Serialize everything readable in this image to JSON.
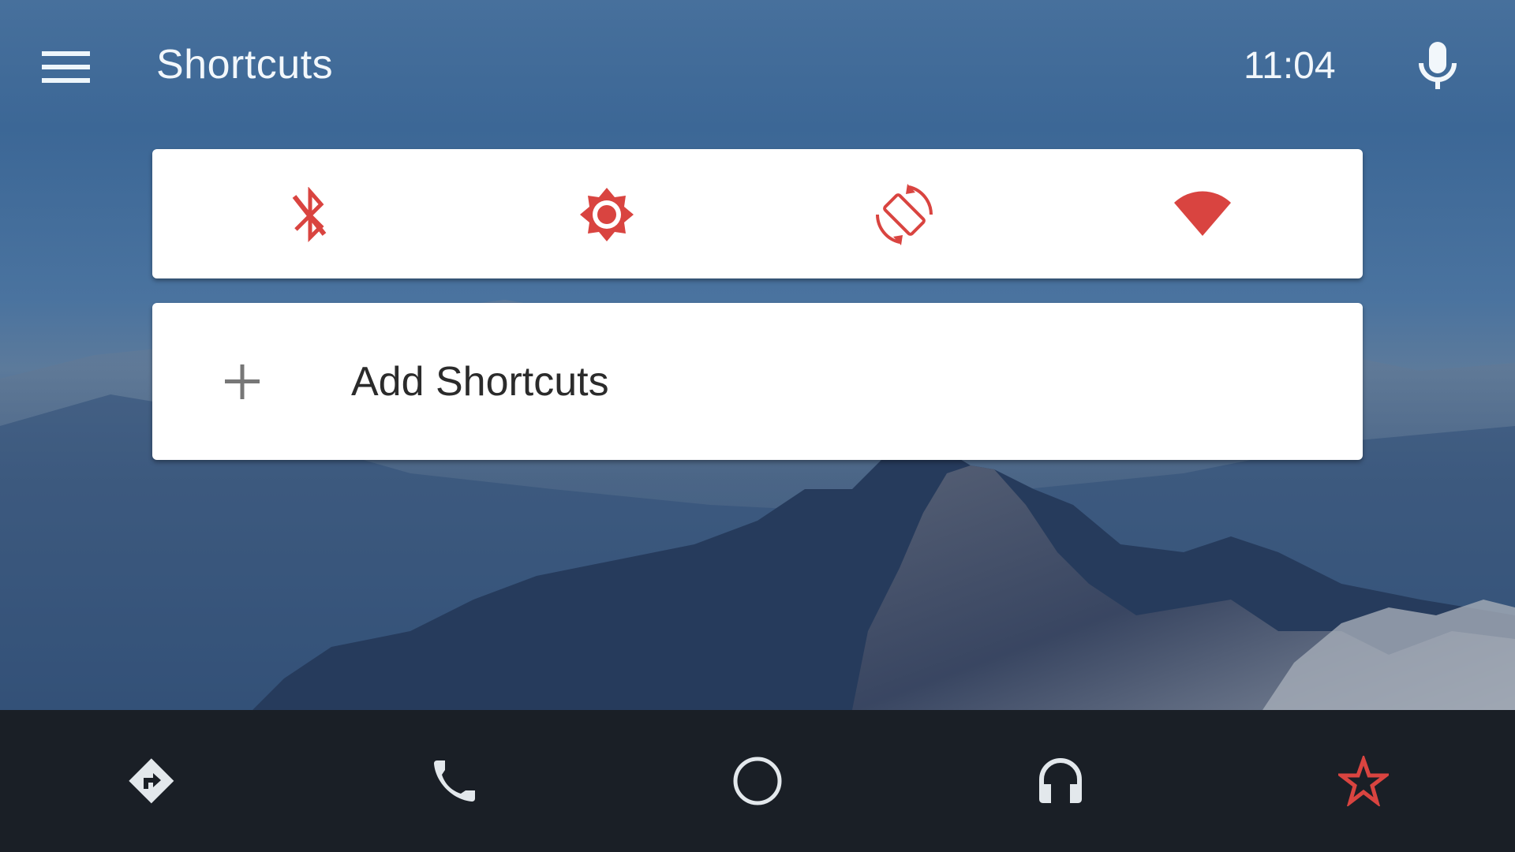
{
  "app_bar": {
    "title": "Shortcuts",
    "time": "11:04",
    "menu_icon": "hamburger-menu-icon",
    "mic_icon": "microphone-icon"
  },
  "quick_settings": [
    {
      "name": "bluetooth",
      "icon": "bluetooth-disabled-icon"
    },
    {
      "name": "brightness",
      "icon": "brightness-icon"
    },
    {
      "name": "auto-rotate",
      "icon": "screen-rotation-icon"
    },
    {
      "name": "wifi",
      "icon": "wifi-signal-icon"
    }
  ],
  "add_card": {
    "icon": "plus-icon",
    "label": "Add Shortcuts"
  },
  "bottom_nav": [
    {
      "name": "navigation",
      "icon": "directions-icon"
    },
    {
      "name": "phone",
      "icon": "phone-icon"
    },
    {
      "name": "home",
      "icon": "home-circle-icon"
    },
    {
      "name": "media",
      "icon": "headphones-icon"
    },
    {
      "name": "shortcuts",
      "icon": "star-icon",
      "active": true
    }
  ],
  "colors": {
    "accent": "#d94440",
    "nav_icon": "#e3e8ec",
    "nav_background": "#1a1f26",
    "card_background": "#ffffff",
    "text_primary": "#2b2b2b"
  }
}
